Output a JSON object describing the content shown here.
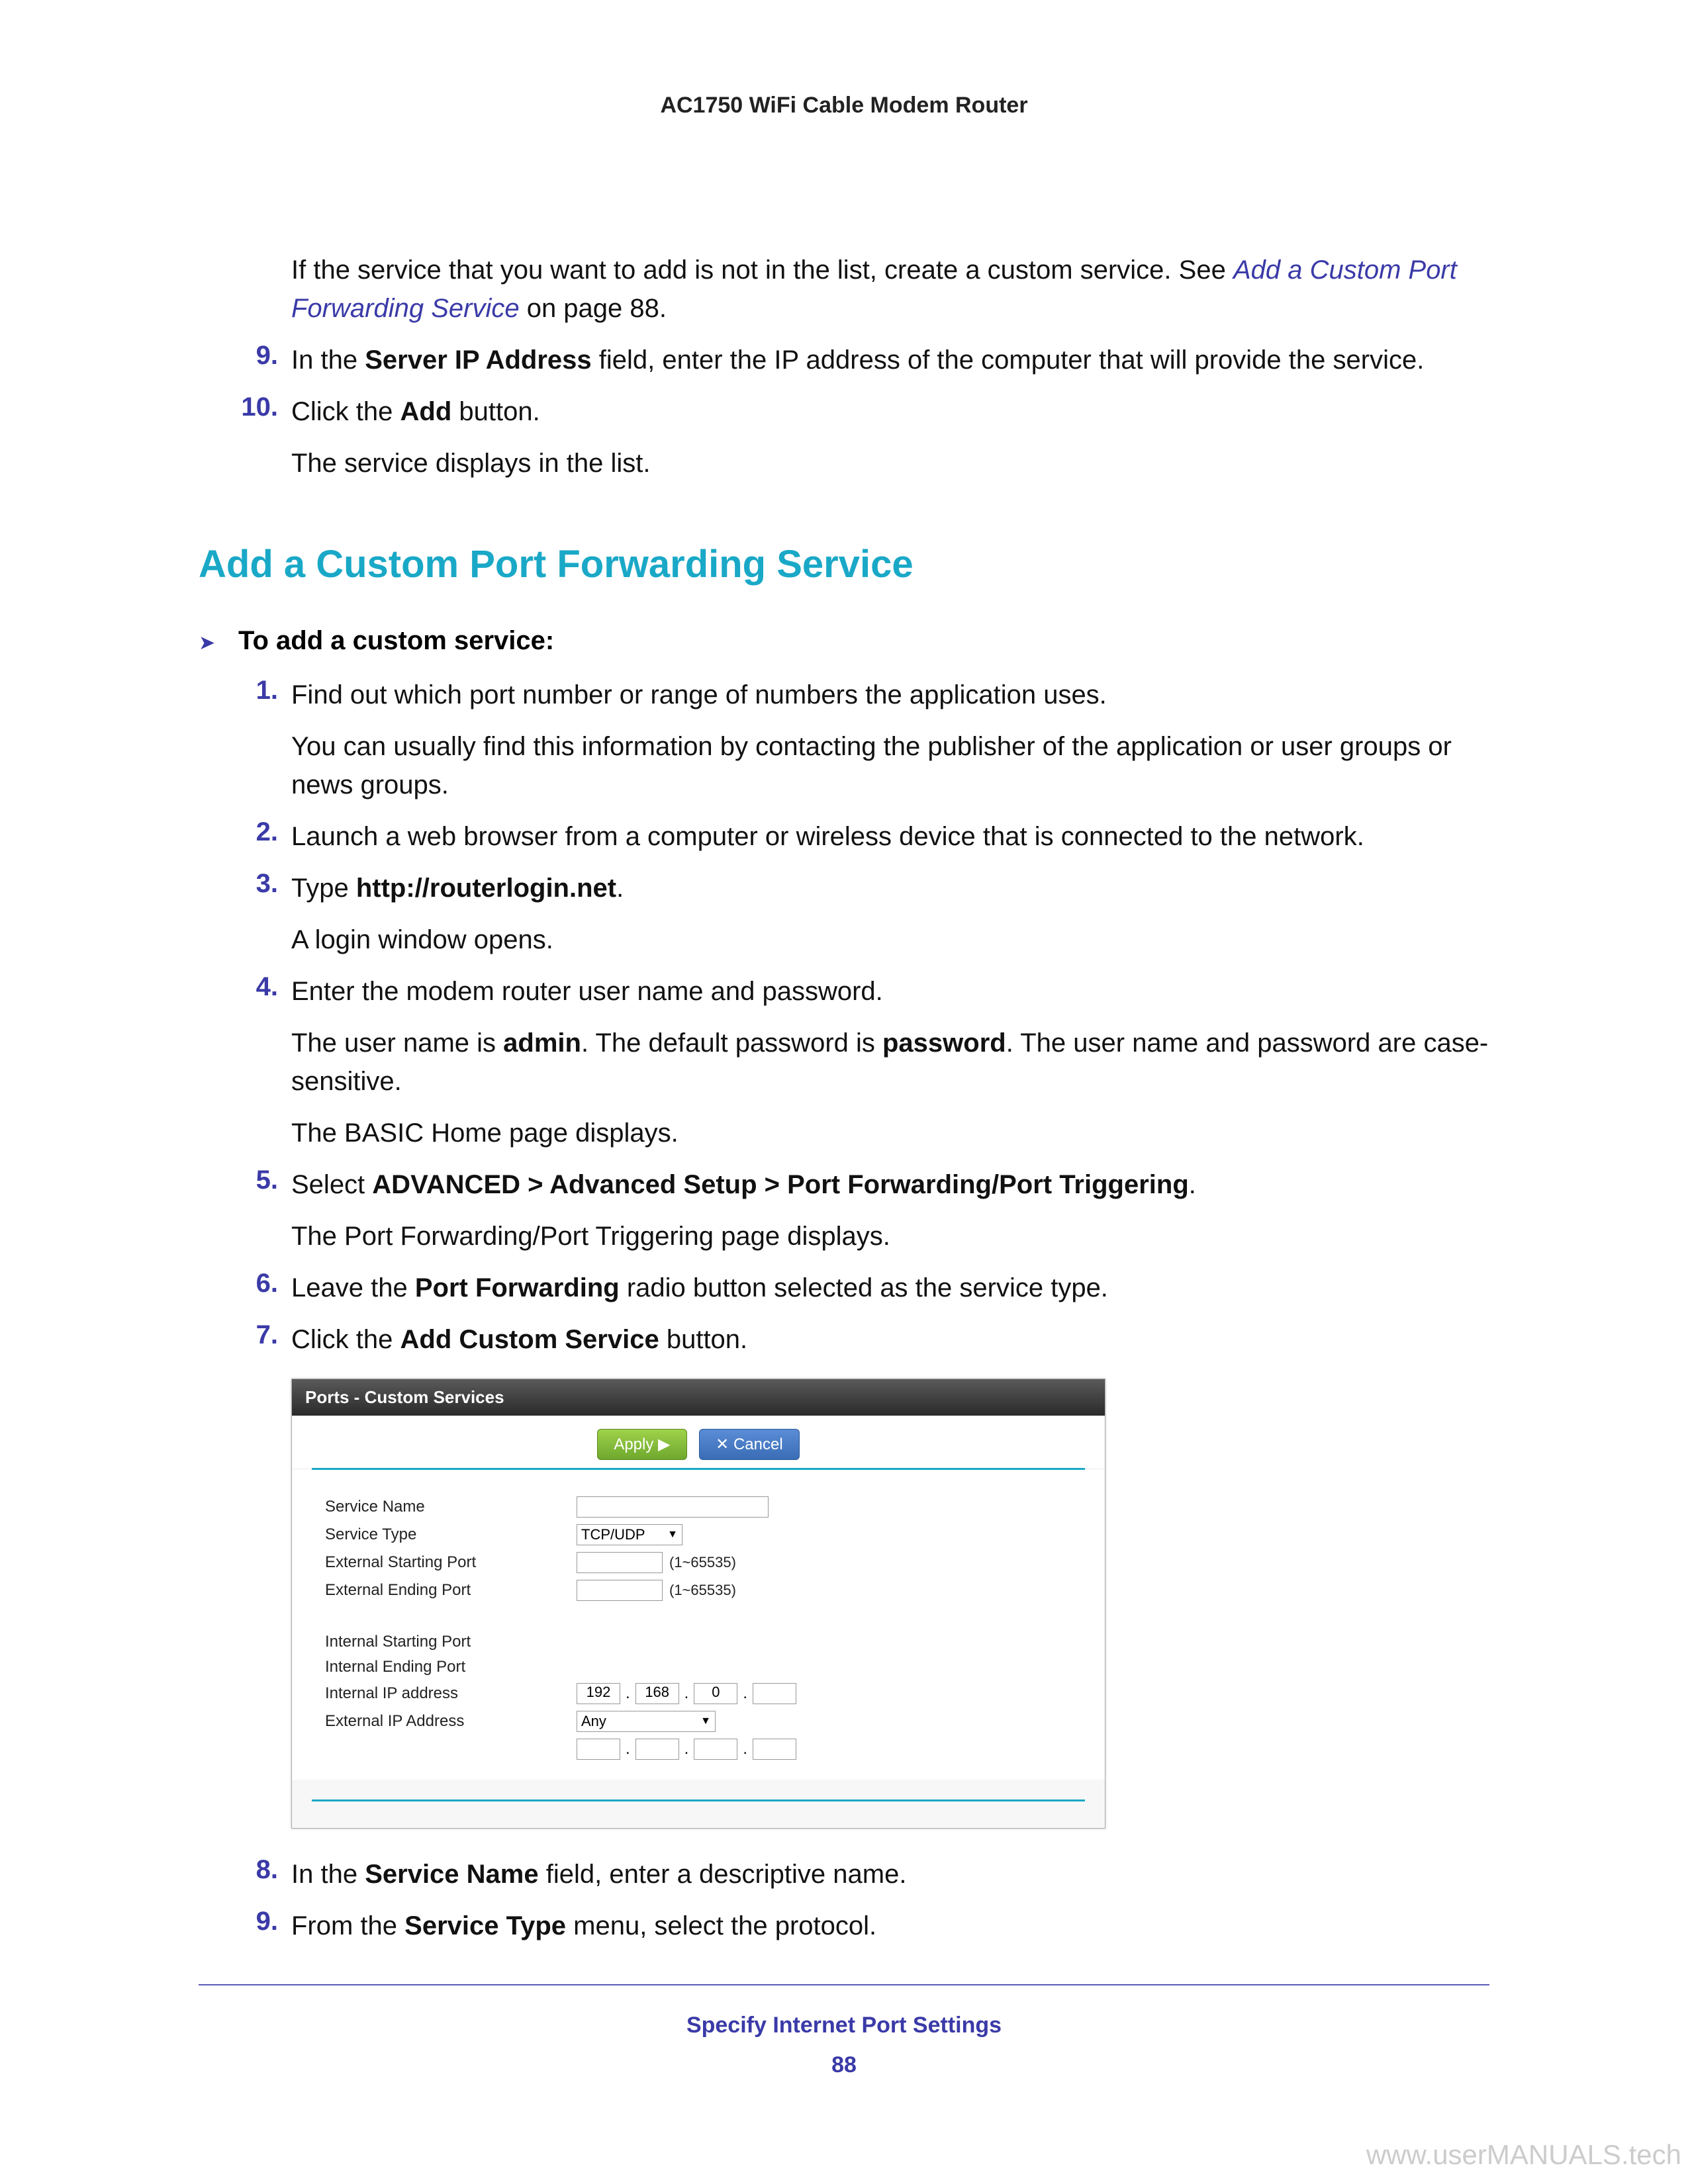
{
  "header": {
    "title": "AC1750 WiFi Cable Modem Router"
  },
  "intro": {
    "pre": "If the service that you want to add is not in the list, create a custom service. See ",
    "link": "Add a Custom Port Forwarding Service",
    "post": " on page 88."
  },
  "steps_top": {
    "nine": {
      "num": "9.",
      "pre": "In the ",
      "bold": "Server IP Address",
      "post": " field, enter the IP address of the computer that will provide the service."
    },
    "ten": {
      "num": "10.",
      "pre": "Click the ",
      "bold": "Add",
      "post": " button."
    },
    "ten_sub": "The service displays in the list."
  },
  "section_heading": "Add a Custom Port Forwarding Service",
  "arrow_text": "To add a custom service:",
  "steps": {
    "s1": {
      "num": "1.",
      "text": "Find out which port number or range of numbers the application uses."
    },
    "s1_sub": "You can usually find this information by contacting the publisher of the application or user groups or news groups.",
    "s2": {
      "num": "2.",
      "text": "Launch a web browser from a computer or wireless device that is connected to the network."
    },
    "s3": {
      "num": "3.",
      "pre": "Type ",
      "bold": "http://routerlogin.net",
      "post": "."
    },
    "s3_sub": "A login window opens.",
    "s4": {
      "num": "4.",
      "text": "Enter the modem router user name and password."
    },
    "s4_sub_a_pre": "The user name is ",
    "s4_sub_a_b1": "admin",
    "s4_sub_a_mid": ". The default password is ",
    "s4_sub_a_b2": "password",
    "s4_sub_a_post": ". The user name and password are case-sensitive.",
    "s4_sub_b": "The BASIC Home page displays.",
    "s5": {
      "num": "5.",
      "pre": "Select ",
      "bold": "ADVANCED > Advanced Setup > Port Forwarding/Port Triggering",
      "post": "."
    },
    "s5_sub": "The Port Forwarding/Port Triggering page displays.",
    "s6": {
      "num": "6.",
      "pre": "Leave the ",
      "bold": "Port Forwarding",
      "post": " radio button selected as the service type."
    },
    "s7": {
      "num": "7.",
      "pre": "Click the ",
      "bold": "Add Custom Service",
      "post": " button."
    },
    "s8": {
      "num": "8.",
      "pre": "In the ",
      "bold": "Service Name",
      "post": " field, enter a descriptive name."
    },
    "s9": {
      "num": "9.",
      "pre": "From the ",
      "bold": "Service Type",
      "post": " menu, select the protocol."
    }
  },
  "screenshot": {
    "title": "Ports - Custom Services",
    "apply": "Apply ▶",
    "cancel": "✕ Cancel",
    "labels": {
      "service_name": "Service Name",
      "service_type": "Service Type",
      "ext_start": "External Starting Port",
      "ext_end": "External Ending Port",
      "int_start": "Internal Starting Port",
      "int_end": "Internal Ending Port",
      "int_ip": "Internal IP address",
      "ext_ip": "External IP Address"
    },
    "values": {
      "service_type": "TCP/UDP",
      "port_hint": "(1~65535)",
      "ip1": "192",
      "ip2": "168",
      "ip3": "0",
      "ip4": "",
      "ext_ip_sel": "Any"
    }
  },
  "footer": {
    "title": "Specify Internet Port Settings",
    "page": "88"
  },
  "watermark": "www.userMANUALS.tech"
}
